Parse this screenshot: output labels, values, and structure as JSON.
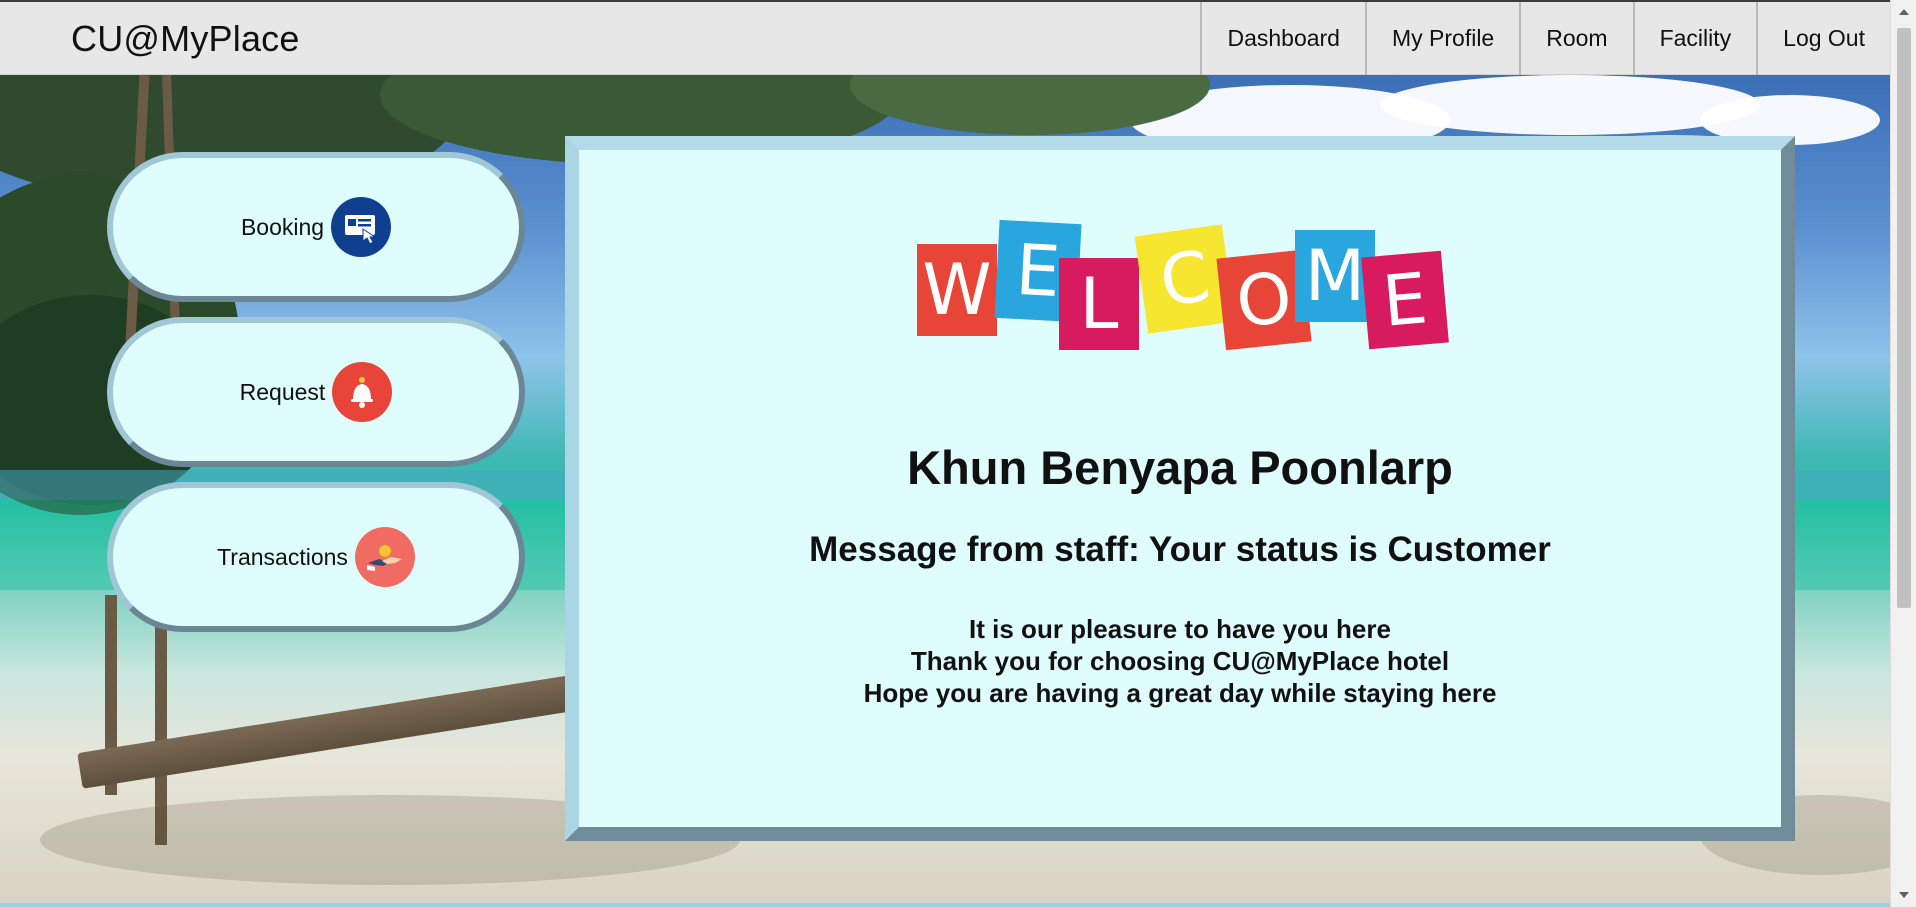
{
  "navbar": {
    "brand": "CU@MyPlace",
    "links": [
      {
        "label": "Dashboard"
      },
      {
        "label": "My Profile"
      },
      {
        "label": "Room"
      },
      {
        "label": "Facility"
      },
      {
        "label": "Log Out"
      }
    ]
  },
  "sidebar": {
    "buttons": [
      {
        "label": "Booking",
        "icon": "booking-card-icon",
        "icon_color": "#0f3f8f"
      },
      {
        "label": "Request",
        "icon": "bell-icon",
        "icon_color": "#e8443a"
      },
      {
        "label": "Transactions",
        "icon": "handshake-coin-icon",
        "icon_color": "#f06b62"
      }
    ]
  },
  "welcome": {
    "logo_letters": [
      "W",
      "E",
      "L",
      "C",
      "O",
      "M",
      "E"
    ],
    "logo_colors": [
      "#e84539",
      "#29a6de",
      "#d81b5e",
      "#f7e630",
      "#e84539",
      "#29a6de",
      "#d81b5e"
    ],
    "guest_name": "Khun Benyapa Poonlarp",
    "staff_message": "Message from staff: Your status is Customer",
    "lines": [
      "It is our pleasure to have you here",
      "Thank you for choosing CU@MyPlace hotel",
      "Hope you are having a great day while staying here"
    ]
  },
  "colors": {
    "panel_bg": "#dffdfd",
    "navbar_bg": "#e7e7e7"
  }
}
